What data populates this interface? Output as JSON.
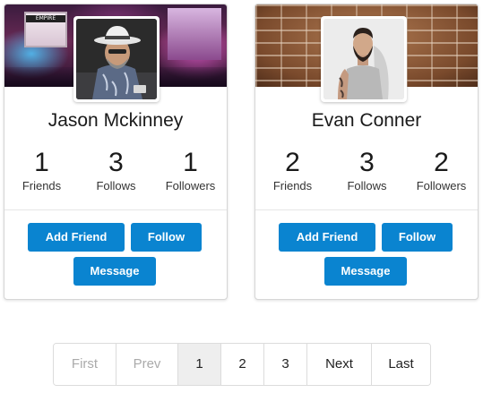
{
  "cards": [
    {
      "name": "Jason Mckinney",
      "banner_sign": "EMPIRE",
      "stats": [
        {
          "value": "1",
          "label": "Friends"
        },
        {
          "value": "3",
          "label": "Follows"
        },
        {
          "value": "1",
          "label": "Followers"
        }
      ],
      "buttons": {
        "add_friend": "Add Friend",
        "follow": "Follow",
        "message": "Message"
      }
    },
    {
      "name": "Evan Conner",
      "stats": [
        {
          "value": "2",
          "label": "Friends"
        },
        {
          "value": "3",
          "label": "Follows"
        },
        {
          "value": "2",
          "label": "Followers"
        }
      ],
      "buttons": {
        "add_friend": "Add Friend",
        "follow": "Follow",
        "message": "Message"
      }
    }
  ],
  "pagination": {
    "first": "First",
    "prev": "Prev",
    "pages": [
      "1",
      "2",
      "3"
    ],
    "current_page": "1",
    "next": "Next",
    "last": "Last"
  },
  "colors": {
    "button_primary": "#0a84d0",
    "active_page_bg": "#eeeeee",
    "disabled_text": "#aaaaaa"
  }
}
